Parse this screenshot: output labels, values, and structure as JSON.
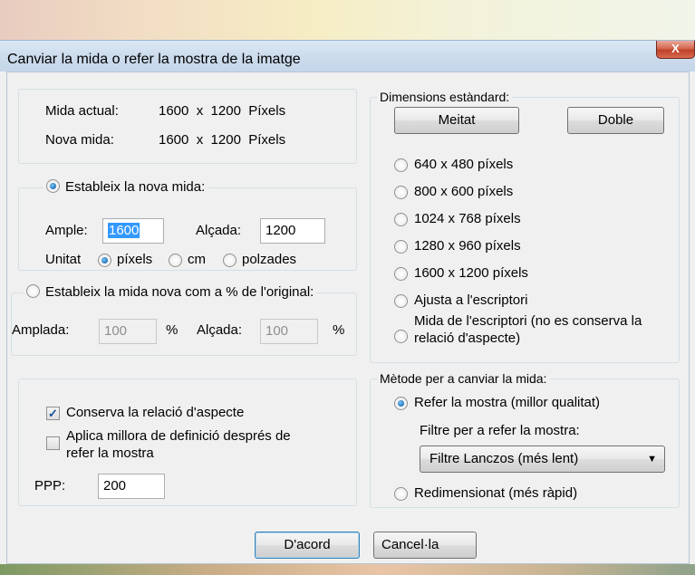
{
  "window": {
    "title": "Canviar la mida o refer la mostra de la imatge",
    "close_label": "X"
  },
  "size_info": {
    "current_label": "Mida actual:",
    "current_value": "1600  x  1200  Píxels",
    "new_label": "Nova mida:",
    "new_value": "1600  x  1200  Píxels"
  },
  "set_size": {
    "radio_label": "Estableix la nova mida:",
    "width_label": "Ample:",
    "width_value": "1600",
    "height_label": "Alçada:",
    "height_value": "1200",
    "unit_label": "Unitat",
    "units": [
      "píxels",
      "cm",
      "polzades"
    ],
    "selected_unit": "píxels"
  },
  "percent": {
    "radio_label": "Estableix la mida nova com a % de l'original:",
    "width_label": "Amplada:",
    "width_value": "100",
    "width_unit": "%",
    "height_label": "Alçada:",
    "height_value": "100",
    "height_unit": "%"
  },
  "options": {
    "keep_ratio_label": "Conserva la relació d'aspecte",
    "keep_ratio_checked": true,
    "sharpen_label_line1": "Aplica millora de definició després de",
    "sharpen_label_line2": "refer la mostra",
    "sharpen_checked": false,
    "dpi_label": "PPP:",
    "dpi_value": "200"
  },
  "standard": {
    "group_title": "Dimensions estàndard:",
    "half_button": "Meitat",
    "double_button": "Doble",
    "presets": [
      "640 x 480 píxels",
      "800 x 600 píxels",
      "1024 x 768 píxels",
      "1280 x 960 píxels",
      "1600 x 1200 píxels",
      "Ajusta a l'escriptori"
    ],
    "desktop_line1": "Mida de l'escriptori (no es conserva la",
    "desktop_line2": "relació d'aspecte)"
  },
  "method": {
    "group_title": "Mètode per a canviar la mida:",
    "resample_label": "Refer la mostra (millor qualitat)",
    "filter_label": "Filtre per a refer la mostra:",
    "filter_value": "Filtre Lanczos (més lent)",
    "resize_label": "Redimensionat (més ràpid)"
  },
  "buttons": {
    "ok": "D'acord",
    "cancel": "Cancel·la"
  }
}
